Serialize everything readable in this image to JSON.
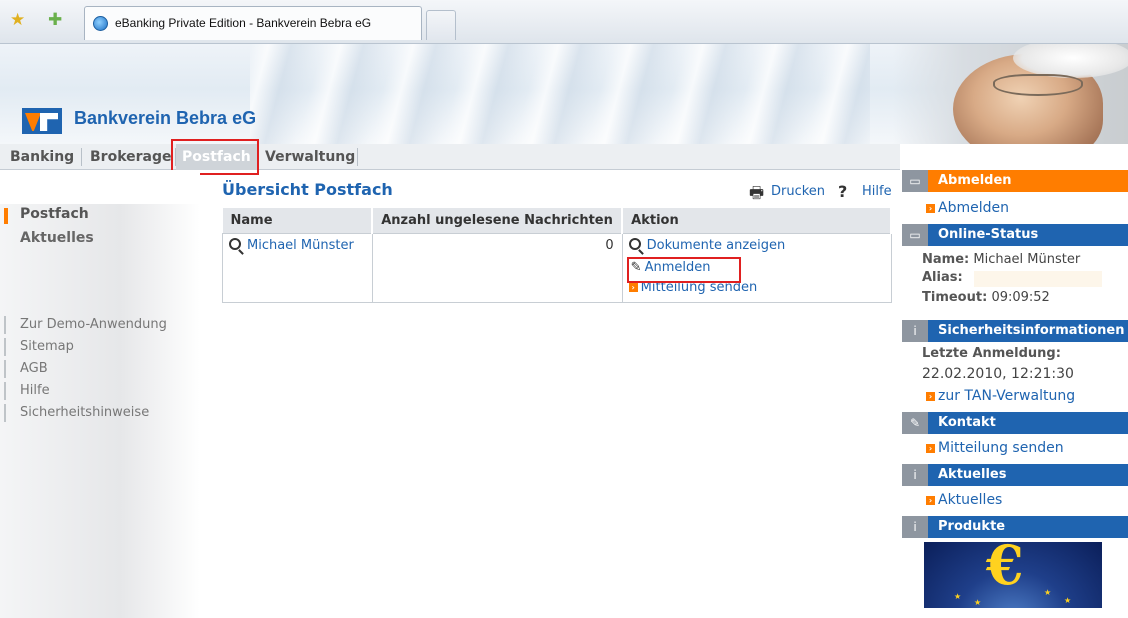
{
  "browser": {
    "tab_title": "eBanking Private Edition - Bankverein Bebra eG"
  },
  "header": {
    "bank_name": "Bankverein Bebra eG"
  },
  "main_nav": {
    "items": [
      {
        "label": "Banking"
      },
      {
        "label": "Brokerage"
      },
      {
        "label": "Postfach",
        "active": true
      },
      {
        "label": "Verwaltung"
      }
    ]
  },
  "left_nav": {
    "items": [
      {
        "label": "Postfach",
        "active": true
      },
      {
        "label": "Aktuelles"
      }
    ],
    "links": [
      {
        "label": "Zur Demo-Anwendung"
      },
      {
        "label": "Sitemap"
      },
      {
        "label": "AGB"
      },
      {
        "label": "Hilfe"
      },
      {
        "label": "Sicherheitshinweise"
      }
    ]
  },
  "content": {
    "title": "Übersicht Postfach",
    "print_label": "Drucken",
    "help_label": "Hilfe",
    "table": {
      "columns": [
        "Name",
        "Anzahl ungelesene Nachrichten",
        "Aktion"
      ],
      "rows": [
        {
          "name": "Michael Münster",
          "unread": "0",
          "actions": [
            "Dokumente anzeigen",
            "Anmelden",
            "Mitteilung senden"
          ]
        }
      ]
    }
  },
  "right_panel": {
    "logout": {
      "title": "Abmelden",
      "link": "Abmelden"
    },
    "online_status": {
      "title": "Online-Status",
      "name_label": "Name:",
      "name_value": "Michael Münster",
      "alias_label": "Alias:",
      "timeout_label": "Timeout:",
      "timeout_value": "09:09:52"
    },
    "security": {
      "title": "Sicherheitsinformationen",
      "last_login_label": "Letzte Anmeldung:",
      "last_login_value": "22.02.2010, 12:21:30",
      "link": "zur TAN-Verwaltung"
    },
    "contact": {
      "title": "Kontakt",
      "link": "Mitteilung senden"
    },
    "news": {
      "title": "Aktuelles",
      "link": "Aktuelles"
    },
    "products": {
      "title": "Produkte"
    }
  },
  "colors": {
    "brand_blue": "#1f64b0",
    "brand_orange": "#ff7d00",
    "highlight_red": "#e02020"
  },
  "icons": [
    "star-icon",
    "add-favorite-icon",
    "ie-icon",
    "printer-icon",
    "help-icon",
    "magnifier-icon",
    "pencil-icon",
    "arrow-icon",
    "euro-icon"
  ]
}
